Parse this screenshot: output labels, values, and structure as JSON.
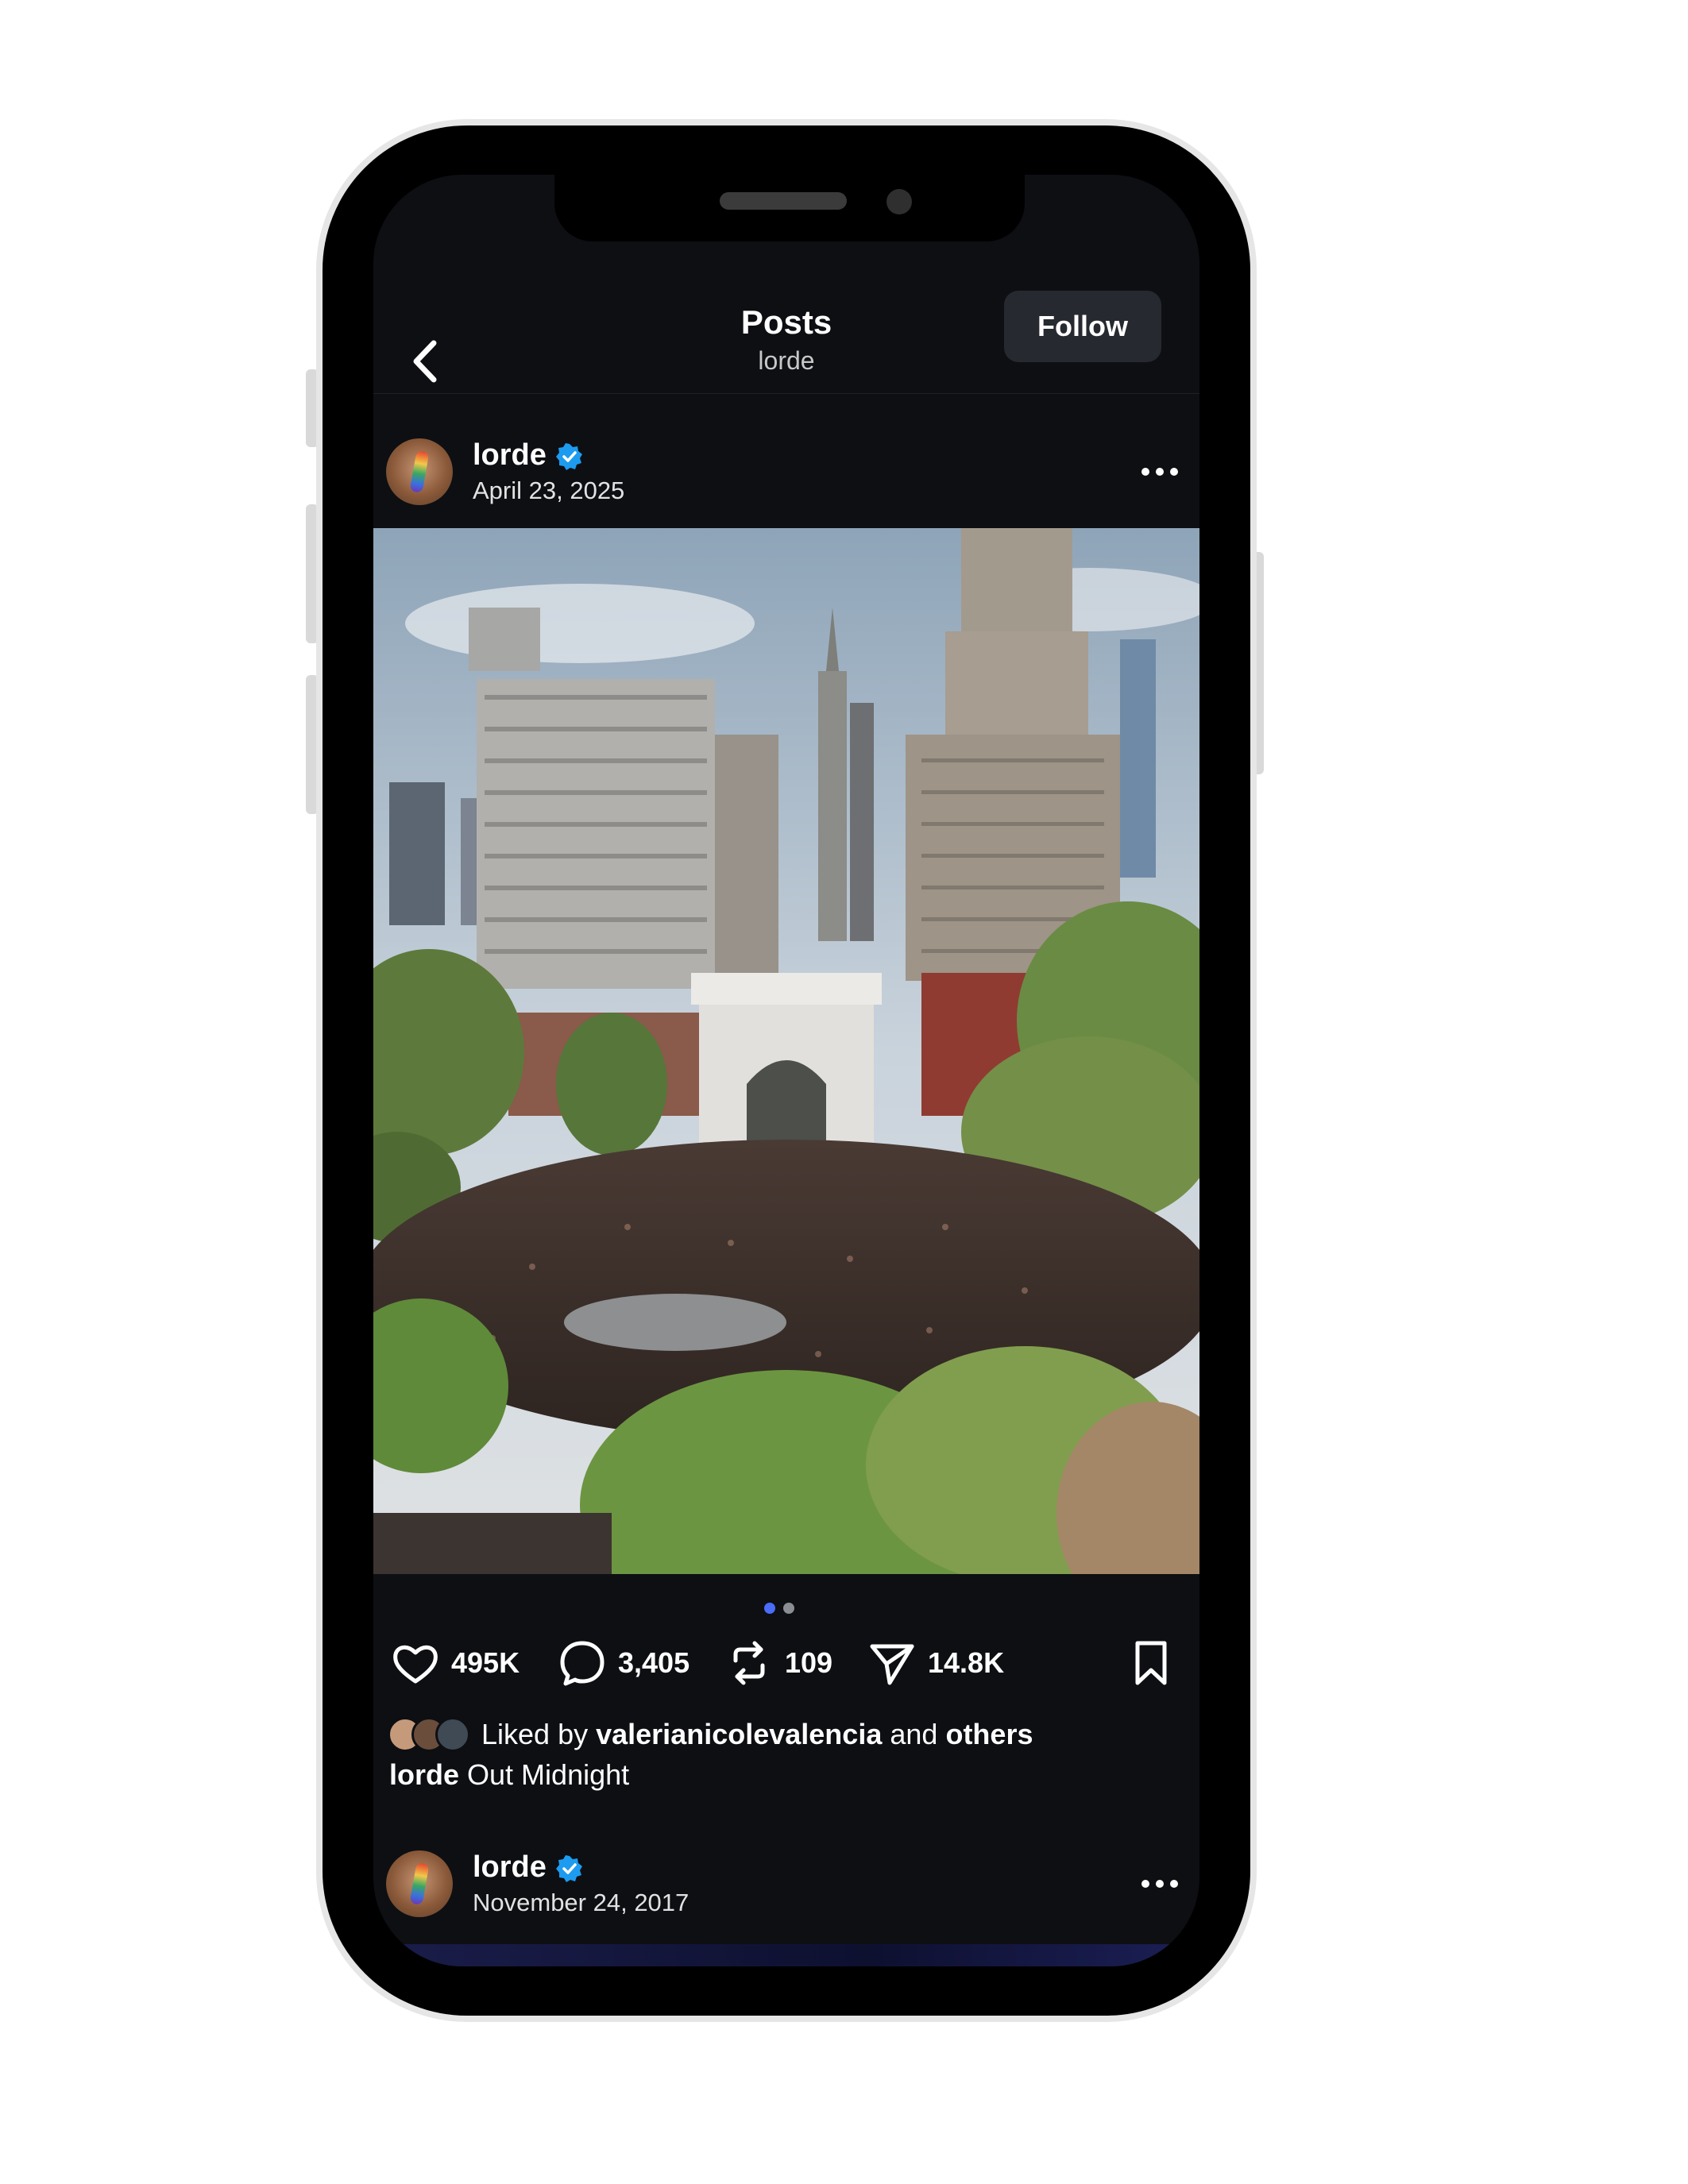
{
  "header": {
    "title": "Posts",
    "subtitle": "lorde",
    "follow_label": "Follow"
  },
  "post": {
    "username": "lorde",
    "date": "April 23, 2025",
    "likes": "495K",
    "comments": "3,405",
    "reposts": "109",
    "shares": "14.8K",
    "liked_by_prefix": "Liked by",
    "liked_by_user": "valerianicolevalencia",
    "liked_by_and": "and",
    "liked_by_others": "others",
    "caption_user": "lorde",
    "caption_text": "Out Midnight",
    "carousel_count": 2,
    "carousel_active": 1
  },
  "next_post": {
    "username": "lorde",
    "date": "November 24, 2017"
  },
  "colors": {
    "background": "#0d0f13",
    "verified": "#1d9bf0",
    "dot_active": "#4a6cf7",
    "dot_inactive": "#8a8d93",
    "follow_bg": "#26292f"
  },
  "icons": [
    "back-chevron-icon",
    "verified-icon",
    "more-icon",
    "heart-icon",
    "comment-icon",
    "repost-icon",
    "share-icon",
    "bookmark-icon"
  ]
}
